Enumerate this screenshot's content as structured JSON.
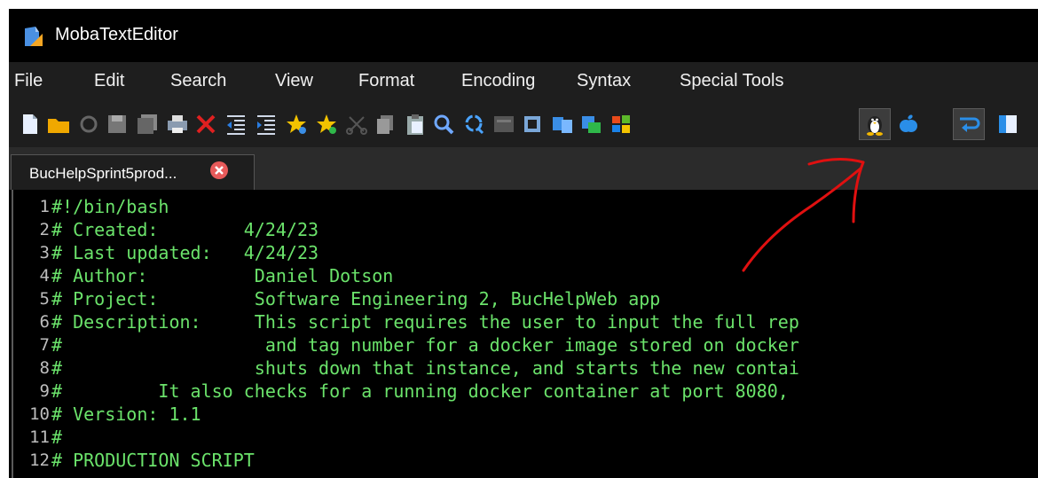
{
  "window": {
    "title": "MobaTextEditor"
  },
  "menu": [
    "File",
    "Edit",
    "Search",
    "View",
    "Format",
    "Encoding",
    "Syntax",
    "Special Tools"
  ],
  "toolbar": {
    "icons": [
      "new-file-icon",
      "open-folder-icon",
      "reload-icon",
      "save-icon",
      "save-all-icon",
      "print-icon",
      "close-icon",
      "unindent-icon",
      "indent-icon",
      "bookmark-star-icon",
      "next-bookmark-star-icon",
      "cut-icon",
      "copy-icon",
      "paste-icon",
      "search-icon",
      "replace-icon",
      "macro-icon",
      "compare-icon",
      "merge-icon",
      "windows-eol-icon",
      "linux-eol-icon",
      "mac-eol-icon",
      "word-wrap-icon",
      "split-view-icon"
    ],
    "active": [
      "linux-eol-icon",
      "word-wrap-icon"
    ]
  },
  "tab": {
    "label": "BucHelpSprint5prod..."
  },
  "editor": {
    "lines": [
      {
        "num": "1",
        "text": "#!/bin/bash"
      },
      {
        "num": "2",
        "text": "# Created:        4/24/23"
      },
      {
        "num": "3",
        "text": "# Last updated:   4/24/23"
      },
      {
        "num": "4",
        "text": "# Author:          Daniel Dotson"
      },
      {
        "num": "5",
        "text": "# Project:         Software Engineering 2, BucHelpWeb app"
      },
      {
        "num": "6",
        "text": "# Description:     This script requires the user to input the full rep"
      },
      {
        "num": "7",
        "text": "#                   and tag number for a docker image stored on docker"
      },
      {
        "num": "8",
        "text": "#                  shuts down that instance, and starts the new contai"
      },
      {
        "num": "9",
        "text": "#         It also checks for a running docker container at port 8080,"
      },
      {
        "num": "10",
        "text": "# Version: 1.1"
      },
      {
        "num": "11",
        "text": "#"
      },
      {
        "num": "12",
        "text": "# PRODUCTION SCRIPT"
      }
    ]
  },
  "colors": {
    "code_text": "#6be36b",
    "annotation": "#e01010"
  }
}
